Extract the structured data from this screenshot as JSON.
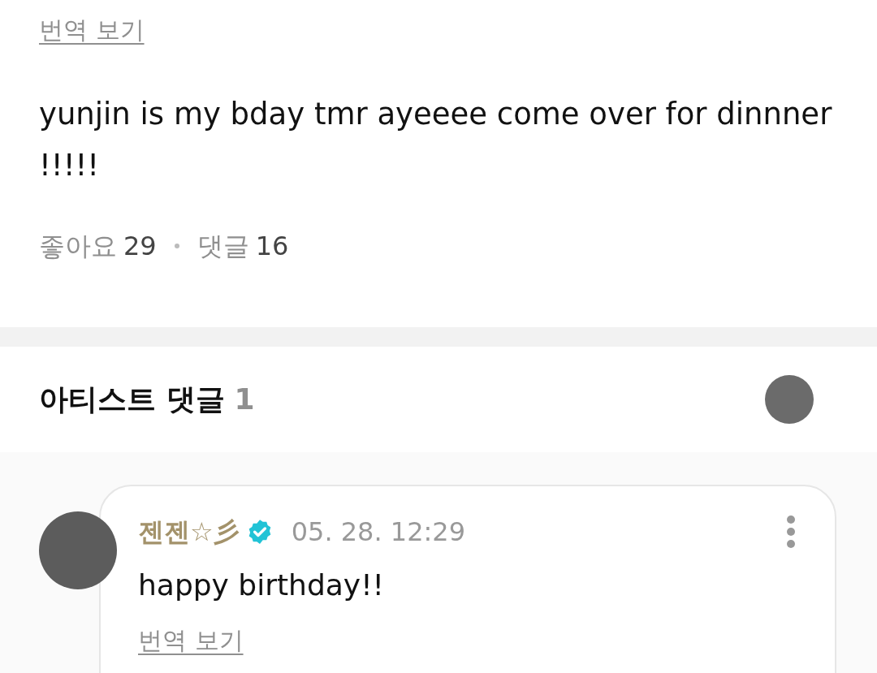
{
  "post": {
    "translate_link": "번역 보기",
    "body": "yunjin is my bday tmr ayeeee come over for dinnner !!!!!",
    "stats": [
      {
        "label": "좋아요",
        "count": "29"
      },
      {
        "label": "댓글",
        "count": "16"
      }
    ]
  },
  "artist_comments": {
    "title": "아티스트 댓글",
    "count": "1",
    "comments": [
      {
        "author": "젠젠☆彡",
        "verified": true,
        "time": "05. 28. 12:29",
        "text": "happy birthday!!",
        "translate_link": "번역 보기"
      }
    ]
  }
}
